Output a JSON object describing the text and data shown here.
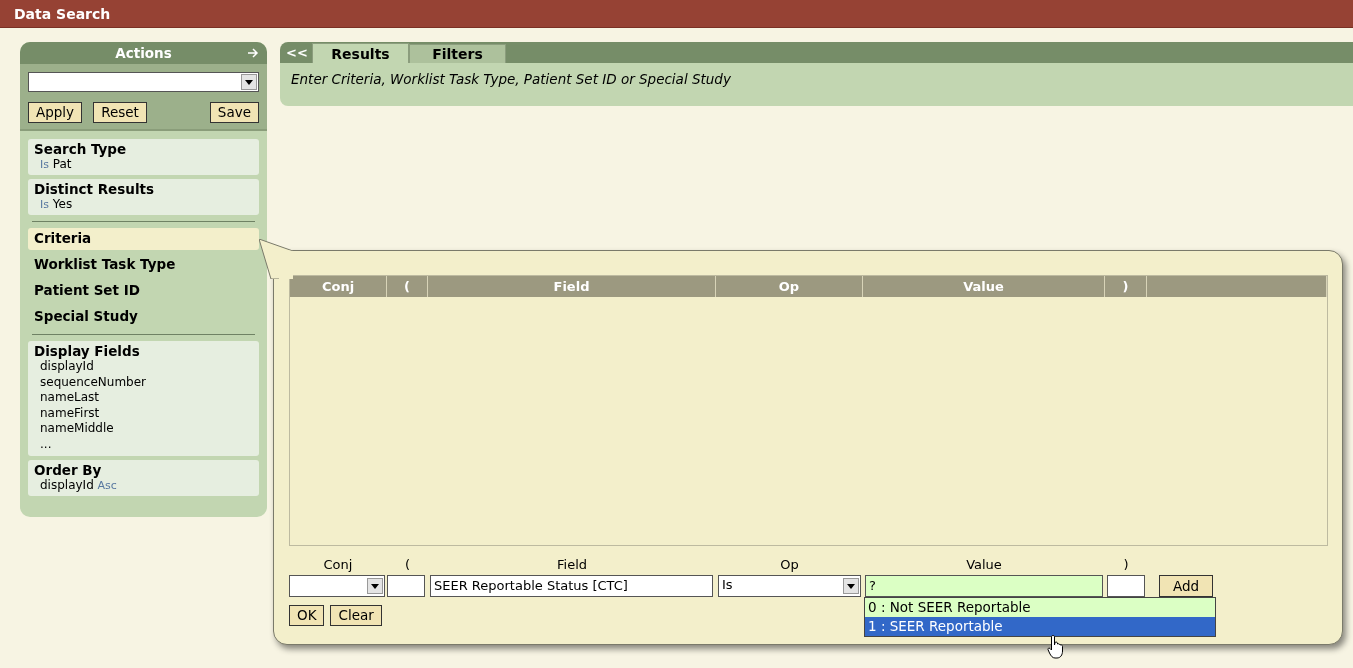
{
  "window": {
    "title": "Data Search"
  },
  "actions": {
    "title": "Actions",
    "buttons": [
      "Apply",
      "Reset",
      "Save"
    ]
  },
  "sidebar": {
    "items": [
      {
        "kind": "summary",
        "title": "Search Type",
        "op": "Is",
        "value": "Pat"
      },
      {
        "kind": "summary",
        "title": "Distinct Results",
        "op": "Is",
        "value": "Yes"
      },
      {
        "kind": "nav",
        "label": "Criteria",
        "selected": true
      },
      {
        "kind": "nav",
        "label": "Worklist Task Type",
        "selected": false
      },
      {
        "kind": "nav",
        "label": "Patient Set ID",
        "selected": false
      },
      {
        "kind": "nav",
        "label": "Special Study",
        "selected": false
      },
      {
        "kind": "list",
        "title": "Display Fields",
        "items": [
          "displayId",
          "sequenceNumber",
          "nameLast",
          "nameFirst",
          "nameMiddle",
          "..."
        ]
      },
      {
        "kind": "order",
        "title": "Order By",
        "field": "displayId",
        "direction": "Asc"
      }
    ]
  },
  "tabs": {
    "collapse": "<<",
    "items": [
      {
        "label": "Results",
        "selected": true
      },
      {
        "label": "Filters",
        "selected": false
      }
    ],
    "hint": "Enter Criteria, Worklist Task Type, Patient Set ID or Special Study"
  },
  "criteria_editor": {
    "table": {
      "columns": [
        "Conj",
        "(",
        "Field",
        "Op",
        "Value",
        ")"
      ]
    },
    "form": {
      "labels": [
        "Conj",
        "(",
        "Field",
        "Op",
        "Value",
        ")"
      ],
      "field": "SEER Reportable Status [CTC]",
      "op": "Is",
      "value": "?",
      "add": "Add",
      "options": [
        {
          "label": "0 : Not SEER Reportable",
          "selected": false
        },
        {
          "label": "1 : SEER Reportable",
          "selected": true
        }
      ]
    },
    "buttons": [
      "OK",
      "Clear"
    ]
  }
}
